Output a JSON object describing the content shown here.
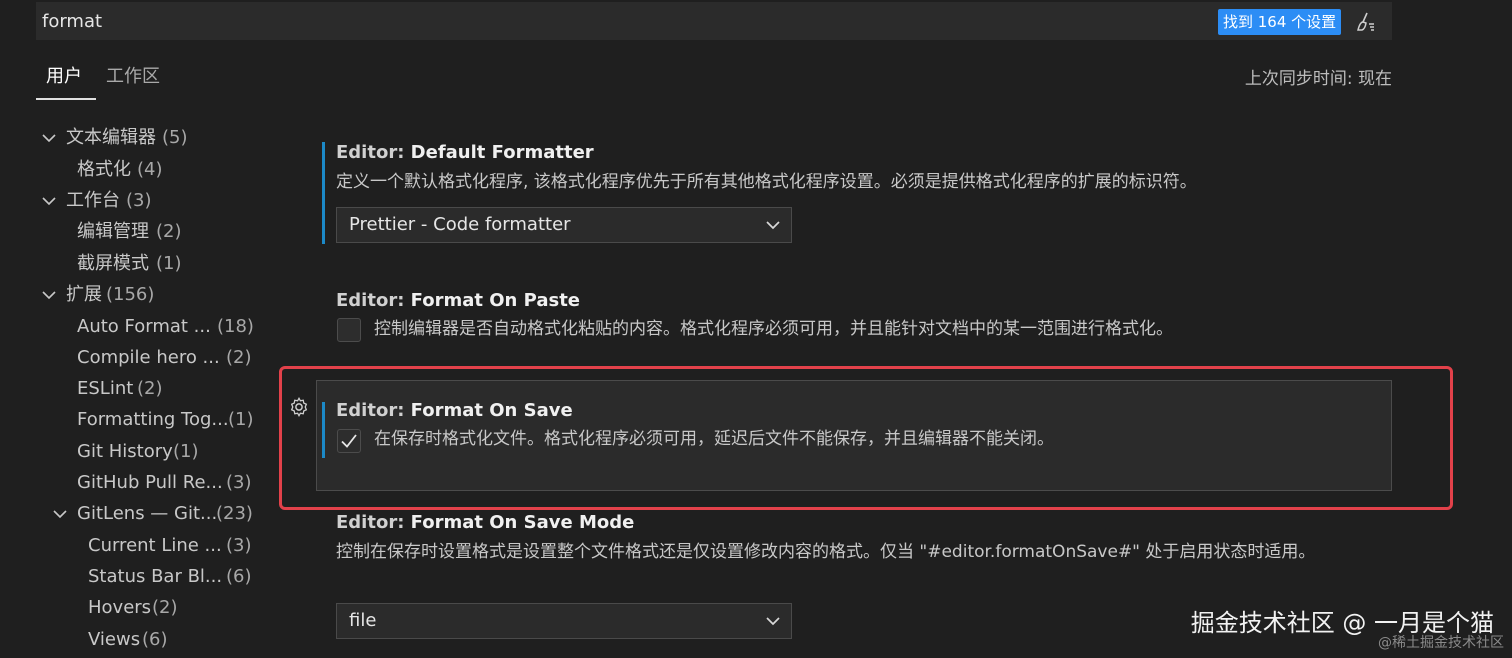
{
  "search": {
    "value": "format",
    "match_badge": "找到 164 个设置",
    "clear_icon": "clear-filter-icon"
  },
  "tabs": [
    {
      "label": "用户",
      "active": true
    },
    {
      "label": "工作区",
      "active": false
    }
  ],
  "sync_status": "上次同步时间: 现在",
  "tree": [
    {
      "label": "文本编辑器",
      "count": "(5)",
      "expanded": true
    },
    {
      "label": "格式化",
      "count": "(4)"
    },
    {
      "label": "工作台",
      "count": "(3)",
      "expanded": true
    },
    {
      "label": "编辑管理",
      "count": "(2)"
    },
    {
      "label": "截屏模式",
      "count": "(1)"
    },
    {
      "label": "扩展",
      "count": "(156)",
      "expanded": true
    },
    {
      "label": "Auto Format ...",
      "count": "(18)"
    },
    {
      "label": "Compile hero ...",
      "count": "(2)"
    },
    {
      "label": "ESLint",
      "count": "(2)"
    },
    {
      "label": "Formatting Tog...",
      "count": "(1)"
    },
    {
      "label": "Git History",
      "count": "(1)"
    },
    {
      "label": "GitHub Pull Re...",
      "count": "(3)"
    },
    {
      "label": "GitLens — Git...",
      "count": "(23)",
      "expanded": true
    },
    {
      "label": "Current Line ...",
      "count": "(3)"
    },
    {
      "label": "Status Bar Bl...",
      "count": "(6)"
    },
    {
      "label": "Hovers",
      "count": "(2)"
    },
    {
      "label": "Views",
      "count": "(6)"
    }
  ],
  "settings": {
    "default_formatter": {
      "category": "Editor: ",
      "name": "Default Formatter",
      "description": "定义一个默认格式化程序, 该格式化程序优先于所有其他格式化程序设置。必须是提供格式化程序的扩展的标识符。",
      "value": "Prettier - Code formatter"
    },
    "format_on_paste": {
      "category": "Editor: ",
      "name": "Format On Paste",
      "description": "控制编辑器是否自动格式化粘贴的内容。格式化程序必须可用，并且能针对文档中的某一范围进行格式化。",
      "checked": false
    },
    "format_on_save": {
      "category": "Editor: ",
      "name": "Format On Save",
      "description": "在保存时格式化文件。格式化程序必须可用，延迟后文件不能保存，并且编辑器不能关闭。",
      "checked": true
    },
    "format_on_save_mode": {
      "category": "Editor: ",
      "name": "Format On Save Mode",
      "description": "控制在保存时设置格式是设置整个文件格式还是仅设置修改内容的格式。仅当 \"#editor.formatOnSave#\" 处于启用状态时适用。",
      "value": "file"
    }
  },
  "watermark": {
    "main": "掘金技术社区 @ 一月是个猫",
    "sub": "@稀土掘金技术社区"
  },
  "colors": {
    "accent": "#1c89c7",
    "badge": "#2c8df5",
    "highlight": "#e2414a",
    "background": "#1f1f1f"
  }
}
